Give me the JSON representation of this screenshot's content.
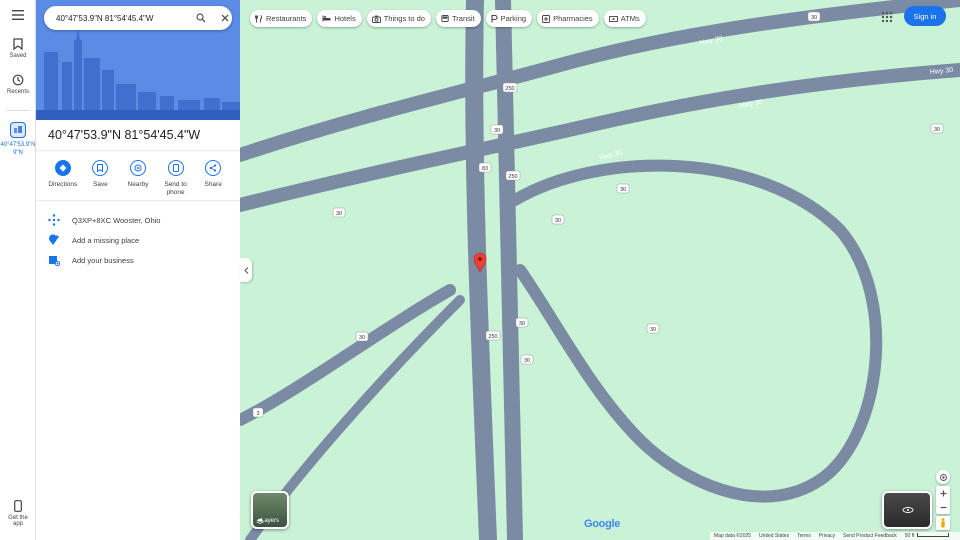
{
  "search": {
    "value": "40°47'53.9\"N 81°54'45.4\"W"
  },
  "rail": {
    "saved": "Saved",
    "recents": "Recents",
    "recent_place": "40°47'53.9\"N",
    "recent_place_line2": "9\"N",
    "get_app_line1": "Get the",
    "get_app_line2": "app"
  },
  "place": {
    "title": "40°47'53.9\"N 81°54'45.4\"W",
    "actions": [
      {
        "label": "Directions",
        "icon": "directions-icon"
      },
      {
        "label": "Save",
        "icon": "bookmark-icon"
      },
      {
        "label": "Nearby",
        "icon": "nearby-icon"
      },
      {
        "label": "Send to",
        "label2": "phone",
        "icon": "phone-icon"
      },
      {
        "label": "Share",
        "icon": "share-icon"
      }
    ],
    "plus_code": "Q3XP+8XC Wooster, Ohio",
    "add_missing": "Add a missing place",
    "add_business": "Add your business"
  },
  "chips": [
    {
      "label": "Restaurants",
      "icon": "restaurant-icon"
    },
    {
      "label": "Hotels",
      "icon": "hotel-icon"
    },
    {
      "label": "Things to do",
      "icon": "camera-icon"
    },
    {
      "label": "Transit",
      "icon": "transit-icon"
    },
    {
      "label": "Parking",
      "icon": "parking-icon"
    },
    {
      "label": "Pharmacies",
      "icon": "pharmacy-icon"
    },
    {
      "label": "ATMs",
      "icon": "atm-icon"
    }
  ],
  "header": {
    "sign_in": "Sign in"
  },
  "map": {
    "road_labels": [
      "Hwy 30",
      "Hwy 30",
      "Hwy 30",
      "Hwy 30"
    ],
    "shields": [
      "250",
      "30",
      "30",
      "83",
      "250",
      "30",
      "30",
      "30",
      "30",
      "30",
      "250",
      "30",
      "30",
      "3",
      "30"
    ],
    "layers_label": "Layers",
    "google": "Google",
    "road_color": "#7a8ba3",
    "land_color": "#c9f2d6",
    "pin_color": "#ea4335"
  },
  "footer": {
    "map_data": "Map data ©2025",
    "country": "United States",
    "terms": "Terms",
    "privacy": "Privacy",
    "feedback": "Send Product Feedback",
    "scale": "50 ft"
  }
}
